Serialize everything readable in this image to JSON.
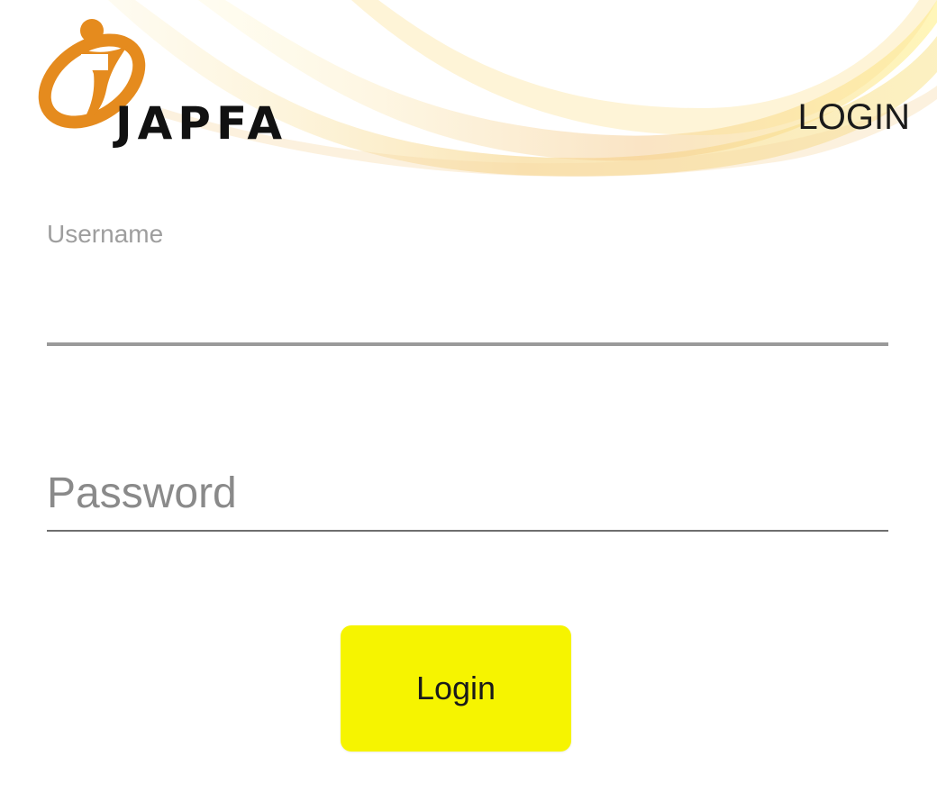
{
  "header": {
    "brand": "JAPFA",
    "title": "LOGIN",
    "logo_icon": "japfa-logo-icon",
    "brand_color": "#E58B1E"
  },
  "form": {
    "username": {
      "label": "Username",
      "value": ""
    },
    "password": {
      "placeholder": "Password",
      "value": ""
    },
    "submit_label": "Login",
    "button_color": "#F6F400"
  }
}
